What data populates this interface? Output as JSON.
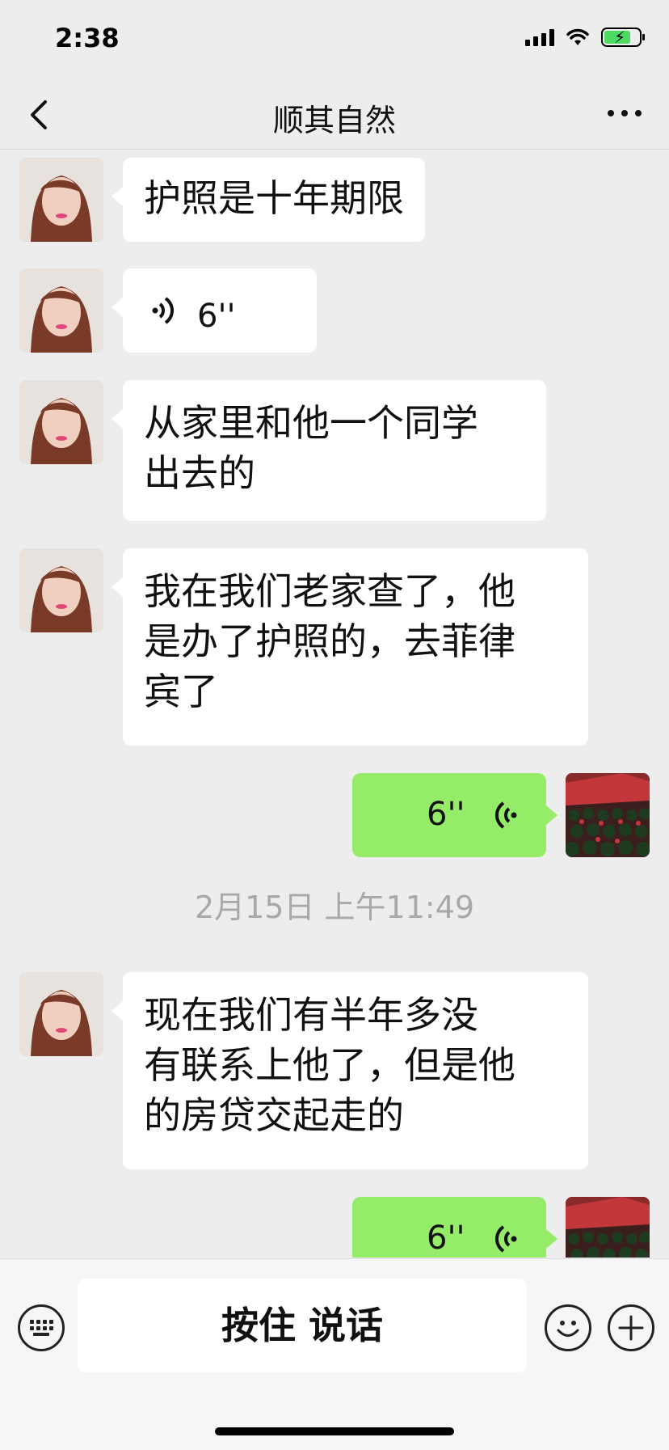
{
  "status_bar": {
    "time": "2:38"
  },
  "nav": {
    "title": "顺其自然"
  },
  "messages": [
    {
      "side": "in",
      "type": "text",
      "text": "护照是十年期限"
    },
    {
      "side": "in",
      "type": "voice",
      "duration": "6''"
    },
    {
      "side": "in",
      "type": "text",
      "lines": [
        "从家里和他一个同学",
        "出去的"
      ]
    },
    {
      "side": "in",
      "type": "text",
      "lines": [
        "我在我们老家查了，他",
        "是办了护照的，去菲律",
        "宾了"
      ]
    },
    {
      "side": "out",
      "type": "voice",
      "duration": "6''"
    },
    {
      "type": "timestamp",
      "text": "2月15日 上午11:49"
    },
    {
      "side": "in",
      "type": "text",
      "lines": [
        "现在我们有半年多没",
        "有联系上他了，但是他",
        "的房贷交起走的"
      ]
    },
    {
      "side": "out",
      "type": "voice",
      "duration": "6''"
    }
  ],
  "input_bar": {
    "talk_label": "按住 说话"
  },
  "colors": {
    "outgoing_bubble": "#95ec69",
    "incoming_bubble": "#ffffff",
    "background": "#ededed"
  },
  "icons": [
    "back-arrow-icon",
    "more-icon",
    "voice-wave-icon",
    "keyboard-icon",
    "emoji-icon",
    "plus-icon"
  ]
}
